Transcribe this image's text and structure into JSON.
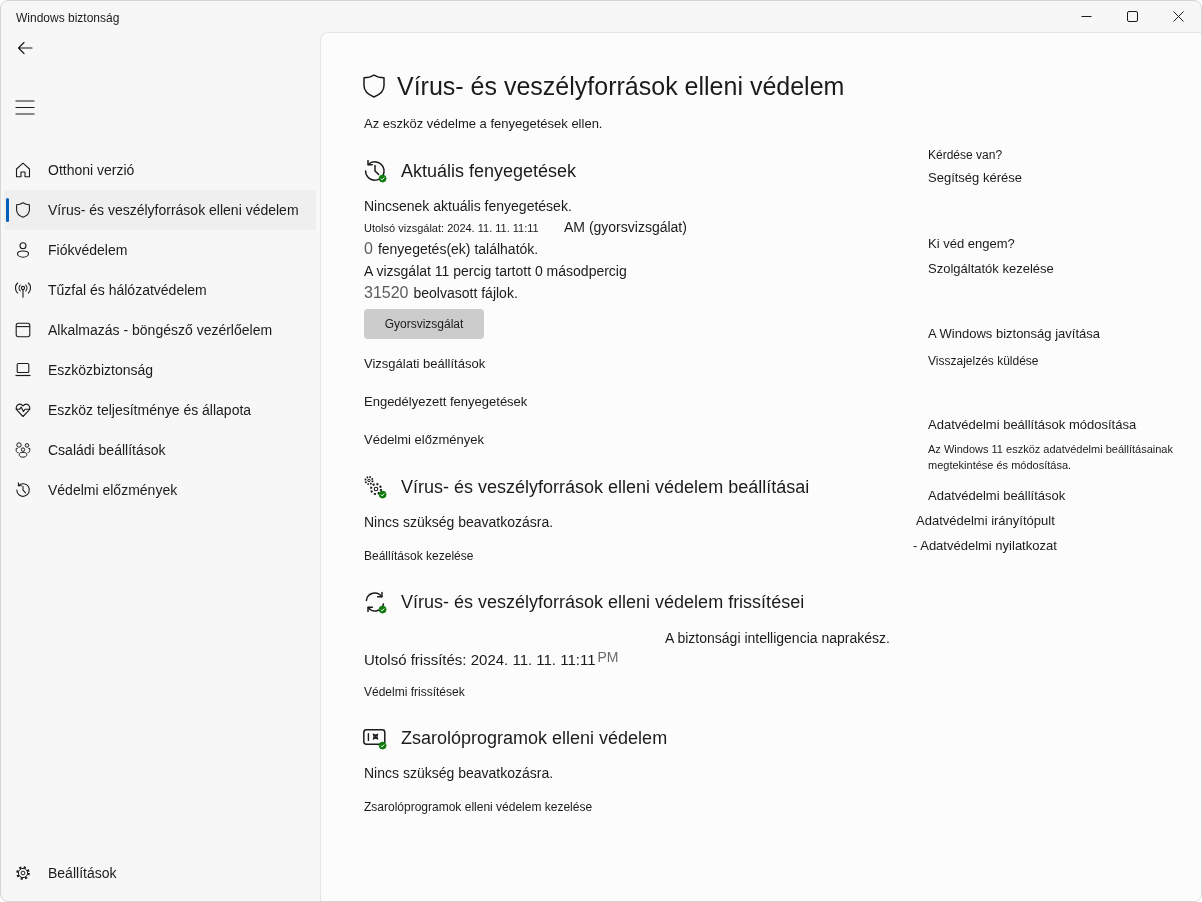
{
  "window": {
    "title": "Windows biztonság"
  },
  "sidebar": {
    "items": [
      {
        "label": "Otthoni verzió",
        "selected": false
      },
      {
        "label": "Vírus- és veszélyforrások elleni védelem",
        "selected": true
      },
      {
        "label": "Fiókvédelem",
        "selected": false
      },
      {
        "label": "Tűzfal és hálózatvédelem",
        "selected": false
      },
      {
        "label": "Alkalmazás - böngésző vezérlőelem",
        "selected": false
      },
      {
        "label": "Eszközbiztonság",
        "selected": false
      },
      {
        "label": "Eszköz teljesítménye és állapota",
        "selected": false
      },
      {
        "label": "Családi beállítások",
        "selected": false
      },
      {
        "label": "Védelmi előzmények",
        "selected": false
      }
    ],
    "settings_item": {
      "label": "Beállítások"
    }
  },
  "page": {
    "title": "Vírus- és veszélyforrások elleni védelem",
    "subtitle": "Az eszköz védelme a fenyegetések ellen."
  },
  "sections": [
    {
      "kind": "threats",
      "healthy": true,
      "title": "Aktuális fenyegetések",
      "status": "Nincsenek aktuális fenyegetések.",
      "last_scan": "Utolsó vizsgálat: 2024. 11. 11. 11:11",
      "scan_type": "AM (gyorsvizsgálat)",
      "threat_count": "0",
      "threat_count_label": "fenyegetés(ek) találhatók.",
      "duration": "A vizsgálat 11 percig tartott 0 másodpercig",
      "file_count": "31520",
      "file_count_label": "beolvasott fájlok.",
      "button": "Gyorsvizsgálat",
      "links": [
        "Vizsgálati beállítások",
        "Engedélyezett fenyegetések",
        "Védelmi előzmények"
      ]
    },
    {
      "kind": "settings",
      "healthy": true,
      "title": "Vírus- és veszélyforrások elleni védelem beállításai",
      "status": "Nincs szükség beavatkozásra.",
      "links": [
        "Beállítások kezelése"
      ]
    },
    {
      "kind": "updates",
      "healthy": true,
      "title": "Vírus- és veszélyforrások elleni védelem frissítései",
      "status": "A biztonsági intelligencia naprakész.",
      "last_update": "Utolsó frissítés: 2024. 11. 11. 11:11",
      "last_update_suffix": "PM",
      "links": [
        "Védelmi frissítések"
      ]
    },
    {
      "kind": "ransomware",
      "healthy": true,
      "title": "Zsarolóprogramok elleni védelem",
      "status": "Nincs szükség beavatkozásra.",
      "links": [
        "Zsarolóprogramok elleni védelem kezelése"
      ]
    }
  ],
  "side_panel": {
    "groups": [
      {
        "heading": "Kérdése van?",
        "links": [
          "Segítség kérése"
        ]
      },
      {
        "heading": "Ki véd engem?",
        "links": [
          "Szolgáltatók kezelése"
        ]
      },
      {
        "heading": "A Windows biztonság javítása",
        "links": [
          "Visszajelzés küldése"
        ]
      },
      {
        "heading": "Adatvédelmi beállítások módosítása",
        "description": "Az Windows 11 eszköz adatvédelmi beállításainak megtekintése és módosítása.",
        "links": [
          "Adatvédelmi beállítások",
          "Adatvédelmi irányítópult",
          "- Adatvédelmi nyilatkozat"
        ]
      }
    ]
  }
}
